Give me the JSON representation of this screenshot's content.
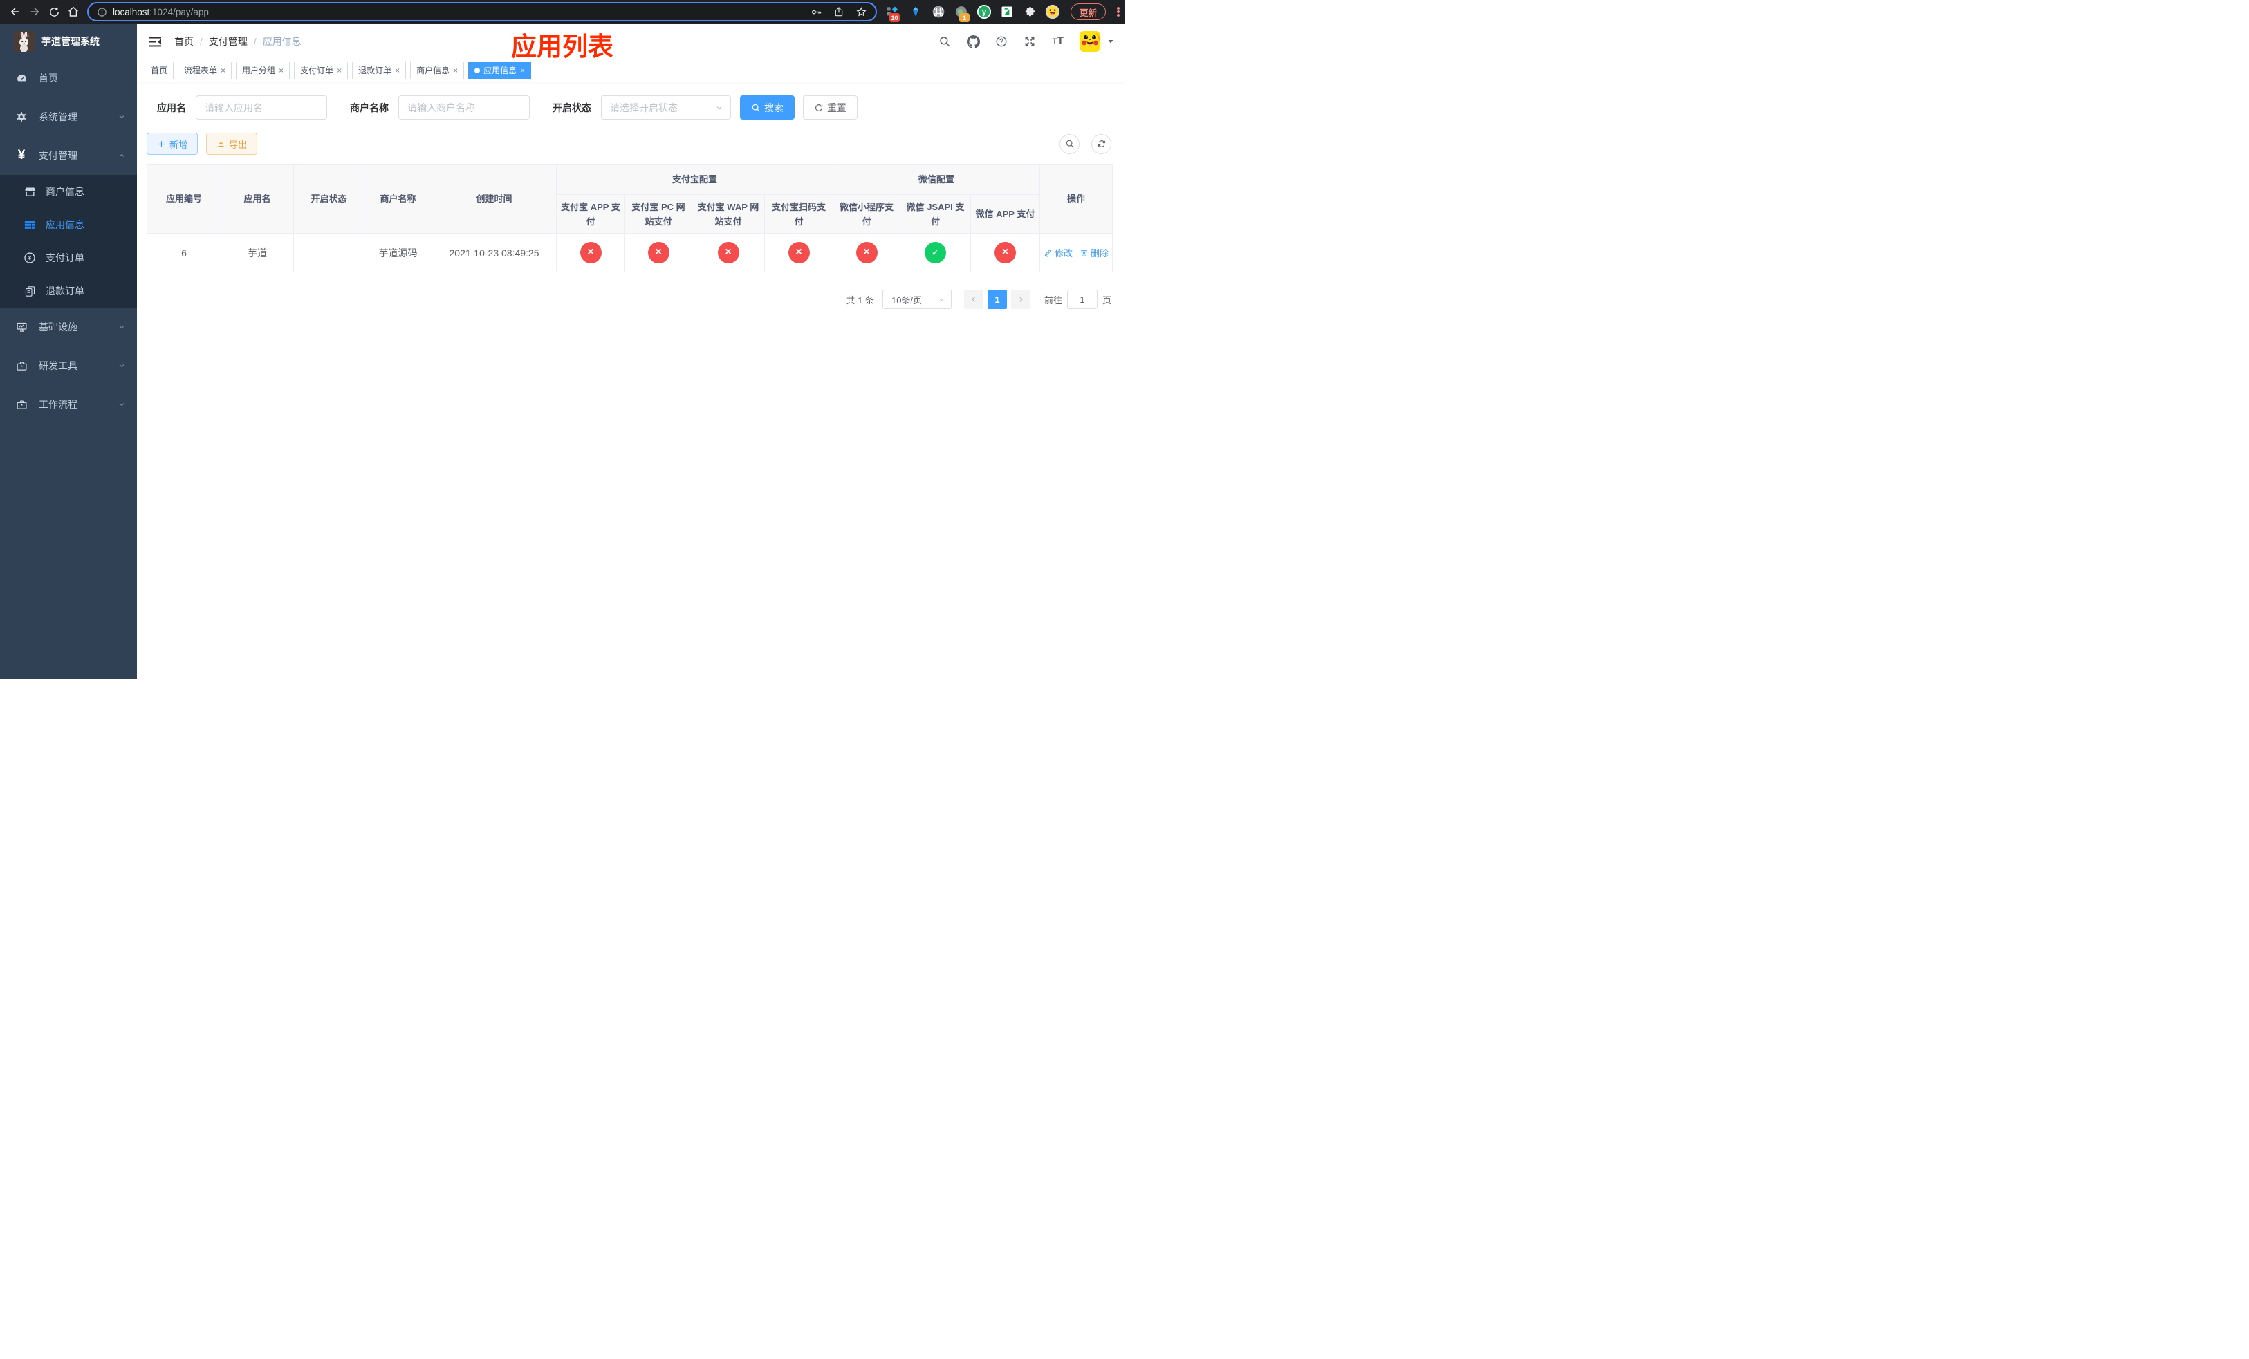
{
  "browser": {
    "url_host": "localhost",
    "url_path": ":1024/pay/app",
    "update_label": "更新",
    "ext_badge_blue_diamond": "10",
    "ext_badge_camera": "1"
  },
  "sidebar": {
    "title": "芋道管理系统",
    "items": [
      {
        "label": "首页"
      },
      {
        "label": "系统管理"
      },
      {
        "label": "支付管理"
      },
      {
        "label": "基础设施"
      },
      {
        "label": "研发工具"
      },
      {
        "label": "工作流程"
      }
    ],
    "submenu": [
      {
        "label": "商户信息"
      },
      {
        "label": "应用信息"
      },
      {
        "label": "支付订单"
      },
      {
        "label": "退款订单"
      }
    ]
  },
  "navbar": {
    "breadcrumb": [
      "首页",
      "支付管理",
      "应用信息"
    ],
    "annotation": "应用列表"
  },
  "tabs": [
    {
      "label": "首页"
    },
    {
      "label": "流程表单"
    },
    {
      "label": "用户分组"
    },
    {
      "label": "支付订单"
    },
    {
      "label": "退款订单"
    },
    {
      "label": "商户信息"
    },
    {
      "label": "应用信息"
    }
  ],
  "filters": {
    "app_name_label": "应用名",
    "app_name_placeholder": "请输入应用名",
    "merchant_label": "商户名称",
    "merchant_placeholder": "请输入商户名称",
    "status_label": "开启状态",
    "status_placeholder": "请选择开启状态",
    "search_label": "搜索",
    "reset_label": "重置"
  },
  "toolbar": {
    "add_label": "新增",
    "export_label": "导出"
  },
  "table": {
    "columns": {
      "app_id": "应用编号",
      "app_name": "应用名",
      "status": "开启状态",
      "merchant": "商户名称",
      "created": "创建时间",
      "alipay_group": "支付宝配置",
      "wechat_group": "微信配置",
      "alipay_app": "支付宝 APP 支付",
      "alipay_pc": "支付宝 PC 网站支付",
      "alipay_wap": "支付宝 WAP 网站支付",
      "alipay_qr": "支付宝扫码支付",
      "wx_lite": "微信小程序支付",
      "wx_jsapi": "微信 JSAPI 支付",
      "wx_app": "微信 APP 支付",
      "actions": "操作"
    },
    "row": {
      "app_id": "6",
      "app_name": "芋道",
      "status_toggle": "on",
      "merchant": "芋道源码",
      "created": "2021-10-23 08:49:25",
      "channels": {
        "alipay_app": "fail",
        "alipay_pc": "fail",
        "alipay_wap": "fail",
        "alipay_qr": "fail",
        "wx_lite": "fail",
        "wx_jsapi": "pass",
        "wx_app": "fail"
      },
      "edit_label": "修改",
      "delete_label": "删除"
    }
  },
  "pagination": {
    "total": "共 1 条",
    "page_size": "10条/页",
    "current_page": "1",
    "goto_label": "前往",
    "goto_value": "1",
    "page_unit": "页"
  }
}
